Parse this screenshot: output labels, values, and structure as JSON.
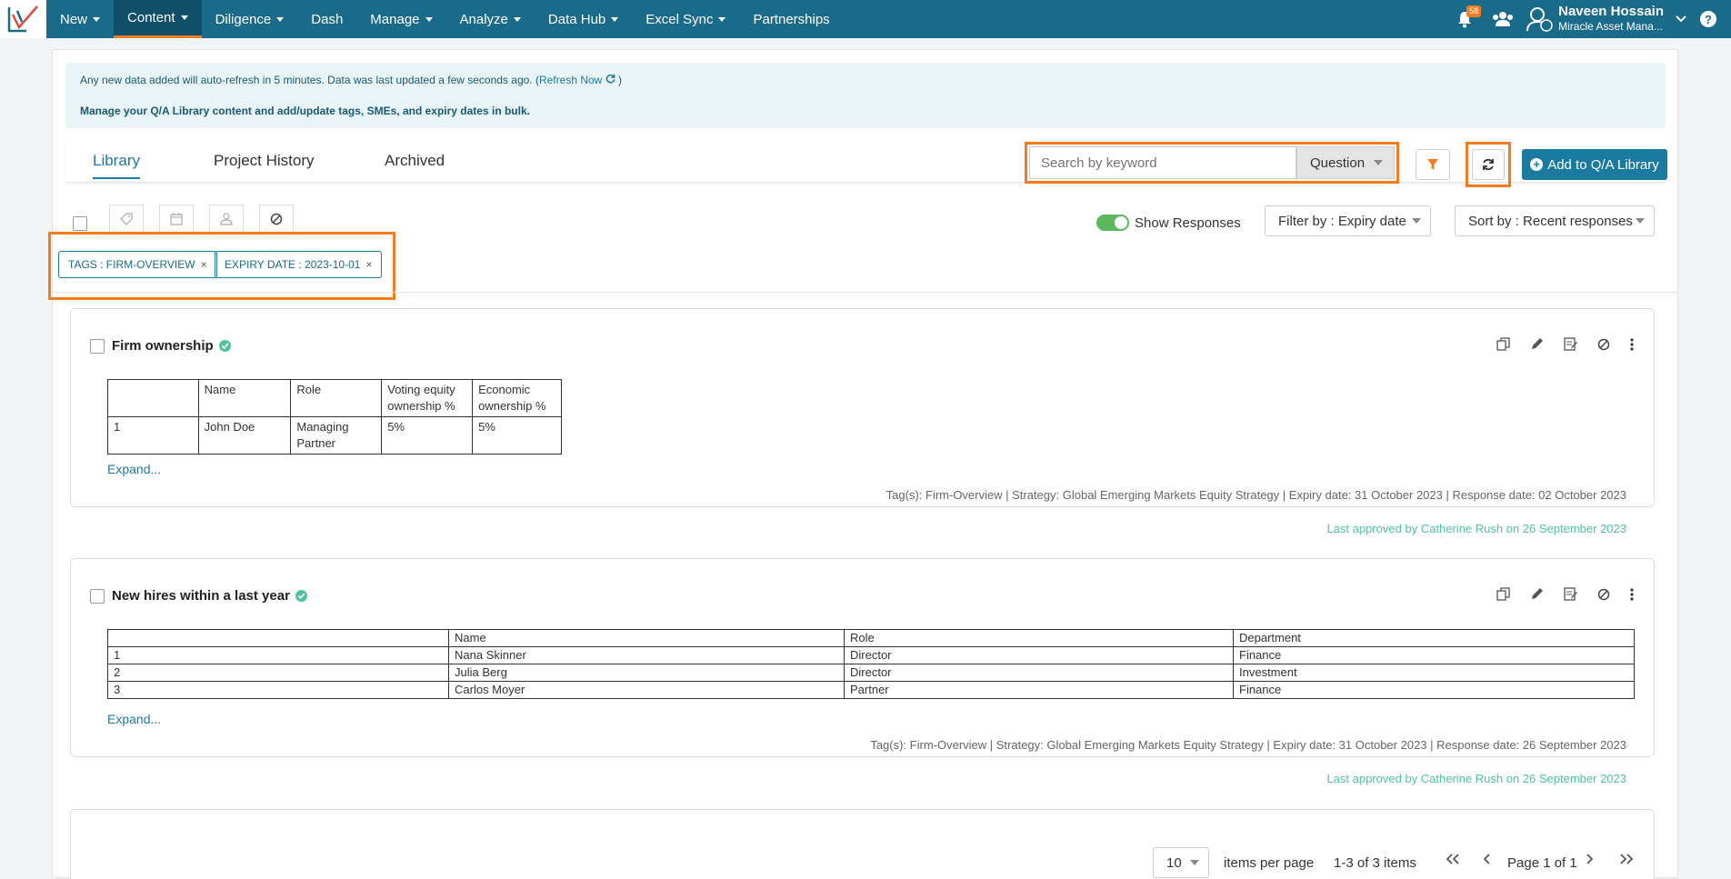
{
  "nav": {
    "items": [
      {
        "label": "New",
        "caret": true
      },
      {
        "label": "Content",
        "caret": true,
        "active": true
      },
      {
        "label": "Diligence",
        "caret": true
      },
      {
        "label": "Dash",
        "caret": false
      },
      {
        "label": "Manage",
        "caret": true
      },
      {
        "label": "Analyze",
        "caret": true
      },
      {
        "label": "Data Hub",
        "caret": true
      },
      {
        "label": "Excel Sync",
        "caret": true
      },
      {
        "label": "Partnerships",
        "caret": false
      }
    ],
    "notification_count": "58",
    "user_name": "Naveen Hossain",
    "user_org": "Miracle Asset Mana...",
    "help": "?"
  },
  "info": {
    "line1": "Any new data added will auto-refresh in 5 minutes. Data was last updated a few seconds ago. (",
    "refresh_link": "Refresh Now",
    "line1_end": " )",
    "line2": "Manage your Q/A Library content and add/update tags, SMEs, and expiry dates in bulk."
  },
  "tabs": [
    "Library",
    "Project History",
    "Archived"
  ],
  "search": {
    "placeholder": "Search by keyword",
    "type": "Question"
  },
  "add_button": "Add to Q/A Library",
  "show_responses": "Show Responses",
  "filter_by": "Filter by : Expiry date",
  "sort_by": "Sort by : Recent responses",
  "chips": [
    {
      "label": "TAGS : FIRM-OVERVIEW"
    },
    {
      "label": "EXPIRY DATE : 2023-10-01"
    }
  ],
  "cards": [
    {
      "title": "Firm ownership",
      "table_header": [
        "",
        "Name",
        "Role",
        "Voting equity ownership %",
        "Economic ownership %"
      ],
      "table_rows": [
        [
          "1",
          "John Doe",
          "Managing Partner",
          "5%",
          "5%"
        ]
      ],
      "expand": "Expand...",
      "meta": "Tag(s):  Firm-Overview | Strategy: Global Emerging Markets Equity Strategy | Expiry date: 31 October 2023 | Response date: 02 October 2023",
      "approved": "Last approved by Catherine Rush on 26 September 2023"
    },
    {
      "title": "New hires within a last year",
      "table_header": [
        "",
        "Name",
        "Role",
        "Department"
      ],
      "table_rows": [
        [
          "1",
          "Nana Skinner",
          "Director",
          "Finance"
        ],
        [
          "2",
          "Julia Berg",
          "Director",
          "Investment"
        ],
        [
          "3",
          "Carlos Moyer",
          "Partner",
          "Finance"
        ]
      ],
      "expand": "Expand...",
      "meta": "Tag(s):  Firm-Overview | Strategy: Global Emerging Markets Equity Strategy | Expiry date: 31 October 2023 | Response date: 26 September 2023",
      "approved": "Last approved by Catherine Rush on 26 September 2023"
    }
  ],
  "pager": {
    "per_page": "10",
    "per_page_label": "items per page",
    "range": "1-3 of 3 items",
    "page": "Page 1 of 1"
  },
  "colors": {
    "nav_bg": "#1a6a8a",
    "accent": "#1a7aa0",
    "highlight": "#f47c20",
    "approved": "#4fc3a1"
  }
}
